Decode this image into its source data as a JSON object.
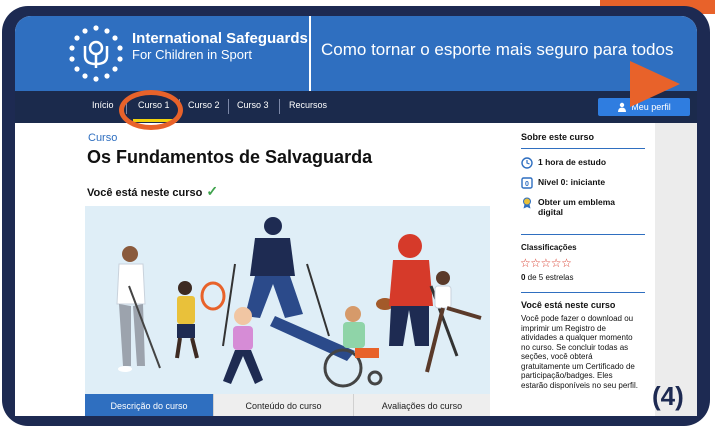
{
  "header": {
    "org_line1": "International Safeguards",
    "org_line2": "For Children in Sport",
    "tagline": "Como tornar o esporte mais seguro para todos"
  },
  "nav": {
    "items": [
      "Início",
      "Curso 1",
      "Curso 2",
      "Curso 3",
      "Recursos"
    ],
    "active": "Curso 1",
    "profile_label": "Meu perfil"
  },
  "main": {
    "breadcrumb": "Curso",
    "title": "Os Fundamentos de Salvaguarda",
    "enrolled_text": "Você está neste curso",
    "tabs": [
      "Descrição do curso",
      "Conteúdo do curso",
      "Avaliações do curso"
    ]
  },
  "sidebar": {
    "about_heading": "Sobre este curso",
    "duration": "1 hora de estudo",
    "level": "Nível 0: iniciante",
    "badge_line1": "Obter um emblema",
    "badge_line2": "digital",
    "ratings_heading": "Classificações",
    "rating_value": 0,
    "rating_max": 5,
    "rating_count_num": "0",
    "rating_count_rest": " de 5 estrelas",
    "enrolled_heading": "Você está neste curso",
    "enrolled_body": "Você pode fazer o download ou imprimir um Registro de atividades a qualquer momento no curso. Se concluir todas as seções, você obterá gratuitamente um Certificado de participação/badges. Eles estarão disponíveis no seu perfil."
  },
  "step_label": "(4)",
  "colors": {
    "header_blue": "#2f6fc0",
    "nav_navy": "#1b2a4c",
    "highlight_orange": "#e8622a",
    "device_frame": "#1d2a52",
    "active_tab_blue": "#2f6fc0"
  }
}
